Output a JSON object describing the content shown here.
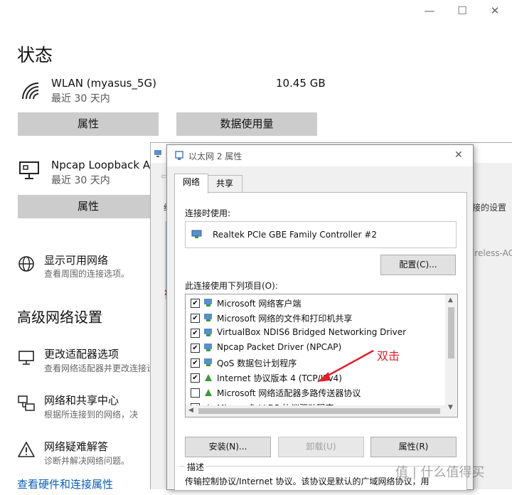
{
  "window": {
    "controls": [
      "—",
      "☐",
      "✕"
    ]
  },
  "settings": {
    "title": "状态",
    "networks": [
      {
        "name": "WLAN (myasus_5G)",
        "sub": "最近 30 天内",
        "usage": "10.45 GB",
        "icon": "wifi-icon",
        "buttons": [
          "属性",
          "数据使用量"
        ]
      },
      {
        "name": "Npcap Loopback Ad",
        "sub": "最近 30 天内",
        "icon": "ethernet-monitor-icon",
        "buttons": [
          "属性"
        ]
      }
    ],
    "show_networks": {
      "title": "显示可用网络",
      "sub": "查看周围的连接选项。",
      "icon": "globe-icon"
    },
    "advanced_title": "高级网络设置",
    "advanced": [
      {
        "title": "更改适配器选项",
        "sub": "查看网络适配器并更改连接设",
        "icon": "monitor-icon"
      },
      {
        "title": "网络和共享中心",
        "sub": "根据所连接到的网络，决",
        "icon": "share-network-icon"
      },
      {
        "title": "网络疑难解答",
        "sub": "诊断并解决网络问题。",
        "icon": "warning-icon"
      }
    ],
    "bottom_link": "查看硬件和连接属性"
  },
  "bg_dialog": {
    "frag_left": "继",
    "frag_right": "接的设置",
    "frag_wireless": "ireless-AC"
  },
  "dialog": {
    "title": "以太网 2 属性",
    "tabs": [
      "网络",
      "共享"
    ],
    "connect_using_label": "连接时使用:",
    "adapter": "Realtek PCIe GBE Family Controller #2",
    "configure_btn": "配置(C)...",
    "items_label": "此连接使用下列项目(O):",
    "items": [
      {
        "text": "Microsoft 网络客户端",
        "checked": true
      },
      {
        "text": "Microsoft 网络的文件和打印机共享",
        "checked": true
      },
      {
        "text": "VirtualBox NDIS6 Bridged Networking Driver",
        "checked": true
      },
      {
        "text": "Npcap Packet Driver (NPCAP)",
        "checked": true
      },
      {
        "text": "QoS 数据包计划程序",
        "checked": true
      },
      {
        "text": "Internet 协议版本 4 (TCP/IPv4)",
        "checked": true
      },
      {
        "text": "Microsoft 网络适配器多路传送器协议",
        "checked": false
      },
      {
        "text": "Microsoft LLDP 协议驱动程序",
        "checked": true
      }
    ],
    "install_btn": "安装(N)...",
    "uninstall_btn": "卸载(U)",
    "properties_btn": "属性(R)",
    "description_label": "描述",
    "description_text": "传输控制协议/Internet 协议。该协议是默认的广域网络协议，用"
  },
  "annotation": {
    "text": "双击",
    "color": "#e0202a"
  },
  "watermark": "值 | 什么值得买"
}
